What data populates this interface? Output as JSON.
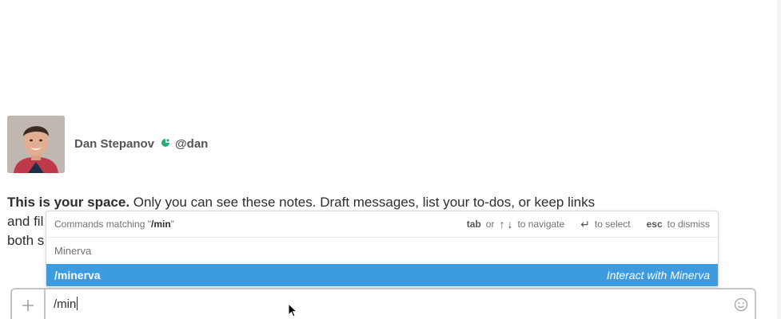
{
  "profile": {
    "name": "Dan Stepanov",
    "handle": "@dan"
  },
  "intro": {
    "bold": "This is your space.",
    "line1": " Only you can see these notes. Draft messages, list your to-dos, or keep links",
    "line2": "and fil",
    "line3": "both s"
  },
  "autocomplete": {
    "header_prefix": "Commands matching \"",
    "query": "/min",
    "header_suffix": "\"",
    "hint_tab_key": "tab",
    "hint_or": "or",
    "hint_navigate": "to navigate",
    "hint_select": "to select",
    "hint_esc_key": "esc",
    "hint_dismiss": "to dismiss",
    "group_label": "Minerva",
    "items": [
      {
        "command": "/minerva",
        "description": "Interact with Minerva",
        "selected": true
      }
    ]
  },
  "composer": {
    "value": "/min"
  },
  "colors": {
    "selected_row": "#3d9be0",
    "presence": "#2bac76"
  },
  "icons": {
    "presence": "presence-icon",
    "plus": "plus-icon",
    "emoji": "emoji-icon",
    "cursor": "mouse-pointer-icon"
  }
}
